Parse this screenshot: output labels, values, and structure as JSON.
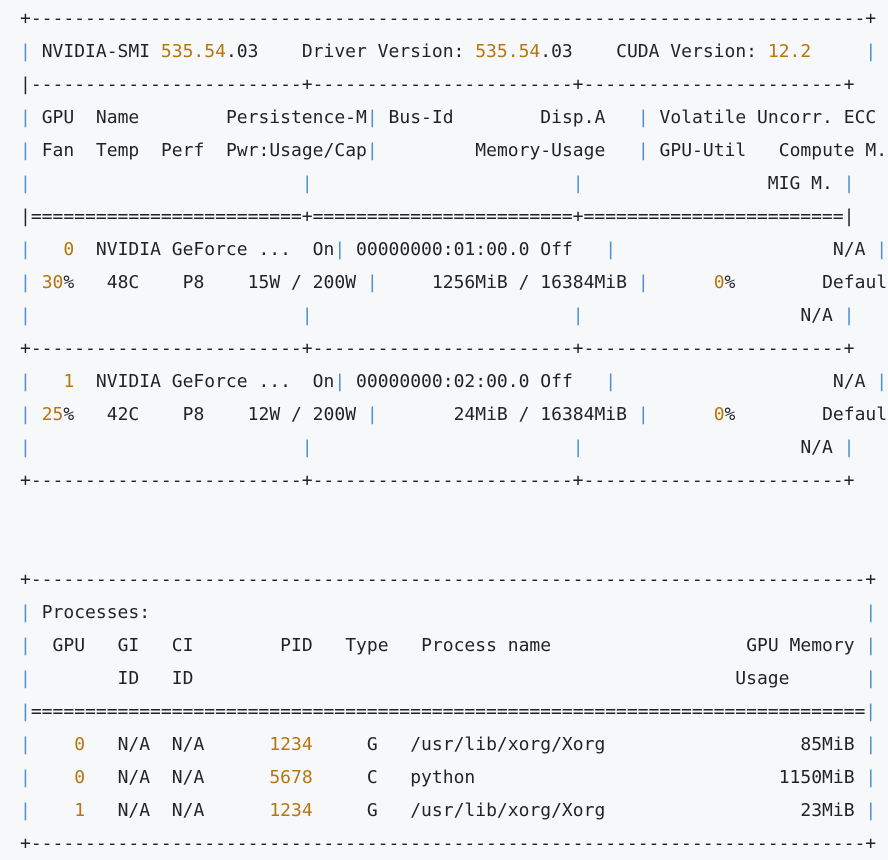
{
  "colors": {
    "background": "#f7f8fa",
    "text": "#1f2328",
    "number": "#b5760f",
    "table_pipe": "#4a90d9"
  },
  "smi": {
    "tool": "NVIDIA-SMI",
    "smi_version": "535.54.03",
    "driver_label": "Driver Version:",
    "driver_version": "535.54.03",
    "cuda_label": "CUDA Version:",
    "cuda_version": "12.2"
  },
  "gpu_table": {
    "header_rows": [
      [
        "GPU",
        "Name",
        "Persistence-M",
        "Bus-Id",
        "Disp.A",
        "Volatile Uncorr. ECC"
      ],
      [
        "Fan",
        "Temp",
        "Perf",
        "Pwr:Usage/Cap",
        "Memory-Usage",
        "GPU-Util",
        "Compute M."
      ],
      [
        "MIG M."
      ]
    ],
    "gpus": [
      {
        "index": "0",
        "name": "NVIDIA GeForce ...",
        "persistence": "On",
        "bus_id": "00000000:01:00.0",
        "disp_a": "Off",
        "ecc": "N/A",
        "fan": "30",
        "temp": "48C",
        "perf": "P8",
        "pwr_usage": "15W",
        "pwr_cap": "200W",
        "mem_used": "1256MiB",
        "mem_total": "16384MiB",
        "util": "0",
        "compute_mode": "Default",
        "mig_mode": "N/A"
      },
      {
        "index": "1",
        "name": "NVIDIA GeForce ...",
        "persistence": "On",
        "bus_id": "00000000:02:00.0",
        "disp_a": "Off",
        "ecc": "N/A",
        "fan": "25",
        "temp": "42C",
        "perf": "P8",
        "pwr_usage": "12W",
        "pwr_cap": "200W",
        "mem_used": "24MiB",
        "mem_total": "16384MiB",
        "util": "0",
        "compute_mode": "Default",
        "mig_mode": "N/A"
      }
    ]
  },
  "processes": {
    "title": "Processes:",
    "header_rows": [
      [
        "GPU",
        "GI",
        "CI",
        "PID",
        "Type",
        "Process name",
        "GPU Memory"
      ],
      [
        "ID",
        "ID",
        "Usage"
      ]
    ],
    "rows": [
      {
        "gpu": "0",
        "gi": "N/A",
        "ci": "N/A",
        "pid": "1234",
        "type": "G",
        "name": "/usr/lib/xorg/Xorg",
        "memory": "85MiB"
      },
      {
        "gpu": "0",
        "gi": "N/A",
        "ci": "N/A",
        "pid": "5678",
        "type": "C",
        "name": "python",
        "memory": "1150MiB"
      },
      {
        "gpu": "1",
        "gi": "N/A",
        "ci": "N/A",
        "pid": "1234",
        "type": "G",
        "name": "/usr/lib/xorg/Xorg",
        "memory": "23MiB"
      }
    ]
  }
}
